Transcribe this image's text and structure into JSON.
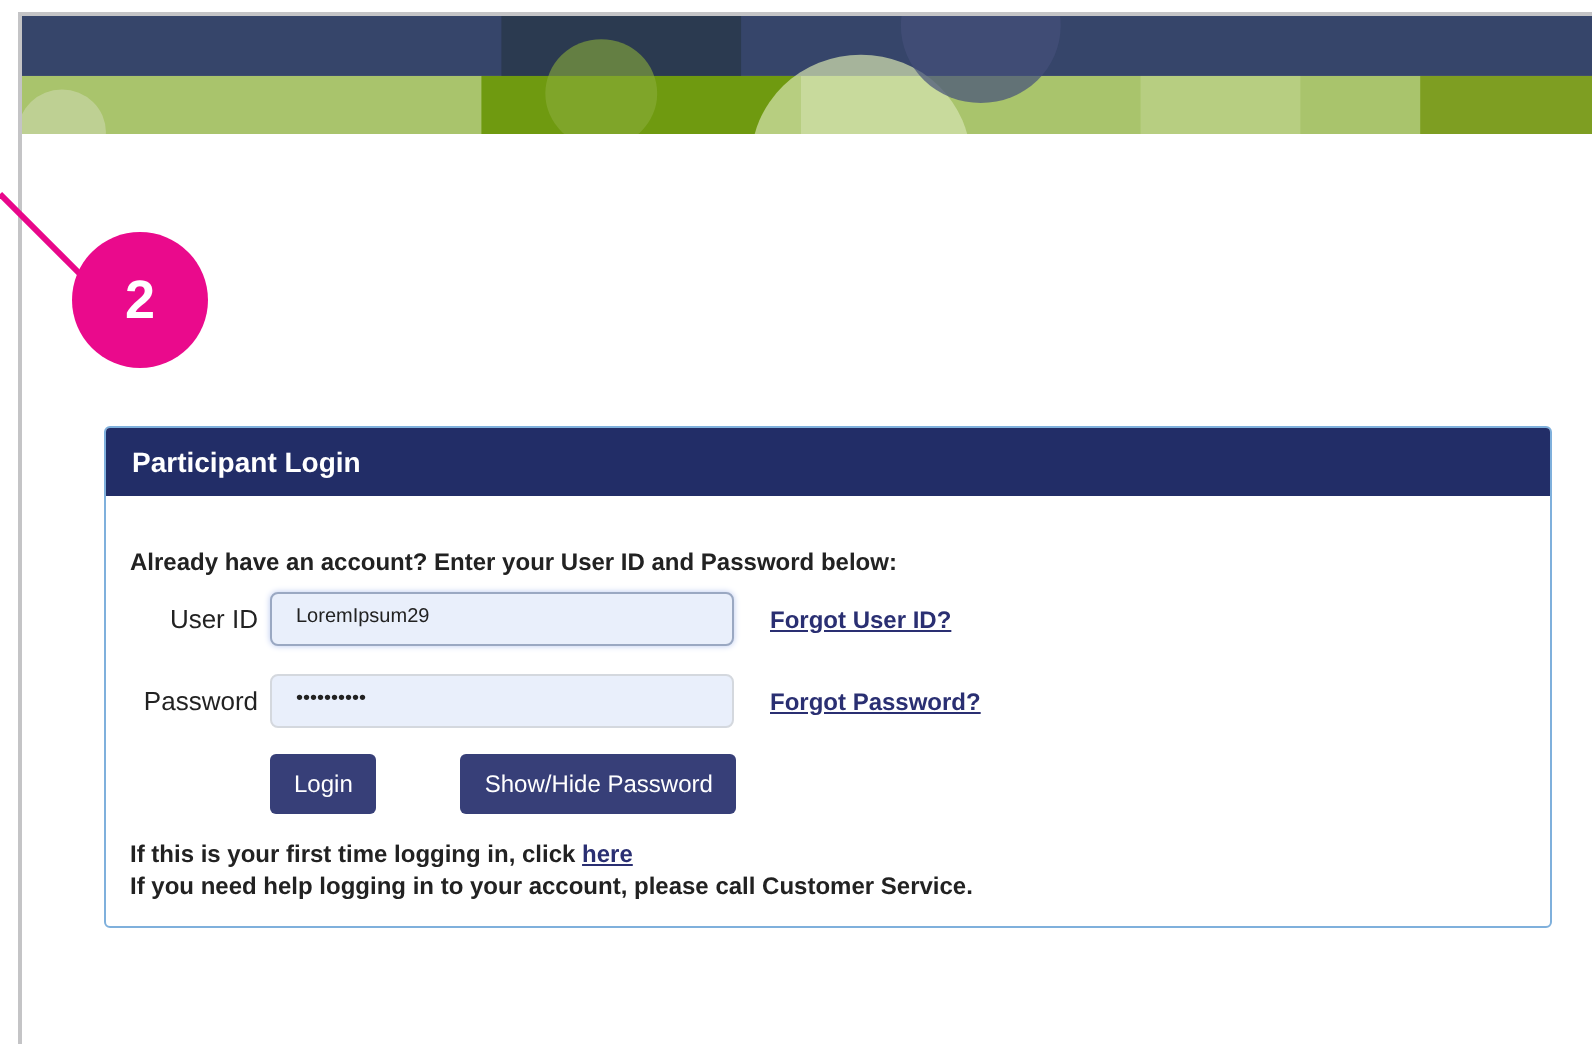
{
  "callout": {
    "number": "2"
  },
  "login_panel": {
    "title": "Participant Login",
    "intro": "Already have an account? Enter your User ID and Password below:",
    "fields": [
      {
        "label": "User ID",
        "value": "LoremIpsum29",
        "focused": true,
        "link": "Forgot User ID?"
      },
      {
        "label": "Password",
        "value": "••••••••••",
        "focused": false,
        "link": "Forgot Password?"
      }
    ],
    "buttons": [
      "Login",
      "Show/Hide Password"
    ],
    "first_time_text": "If this is your first time logging in, click ",
    "first_time_link": "here",
    "help_text": "If you need help logging in to your account, please call Customer Service."
  }
}
